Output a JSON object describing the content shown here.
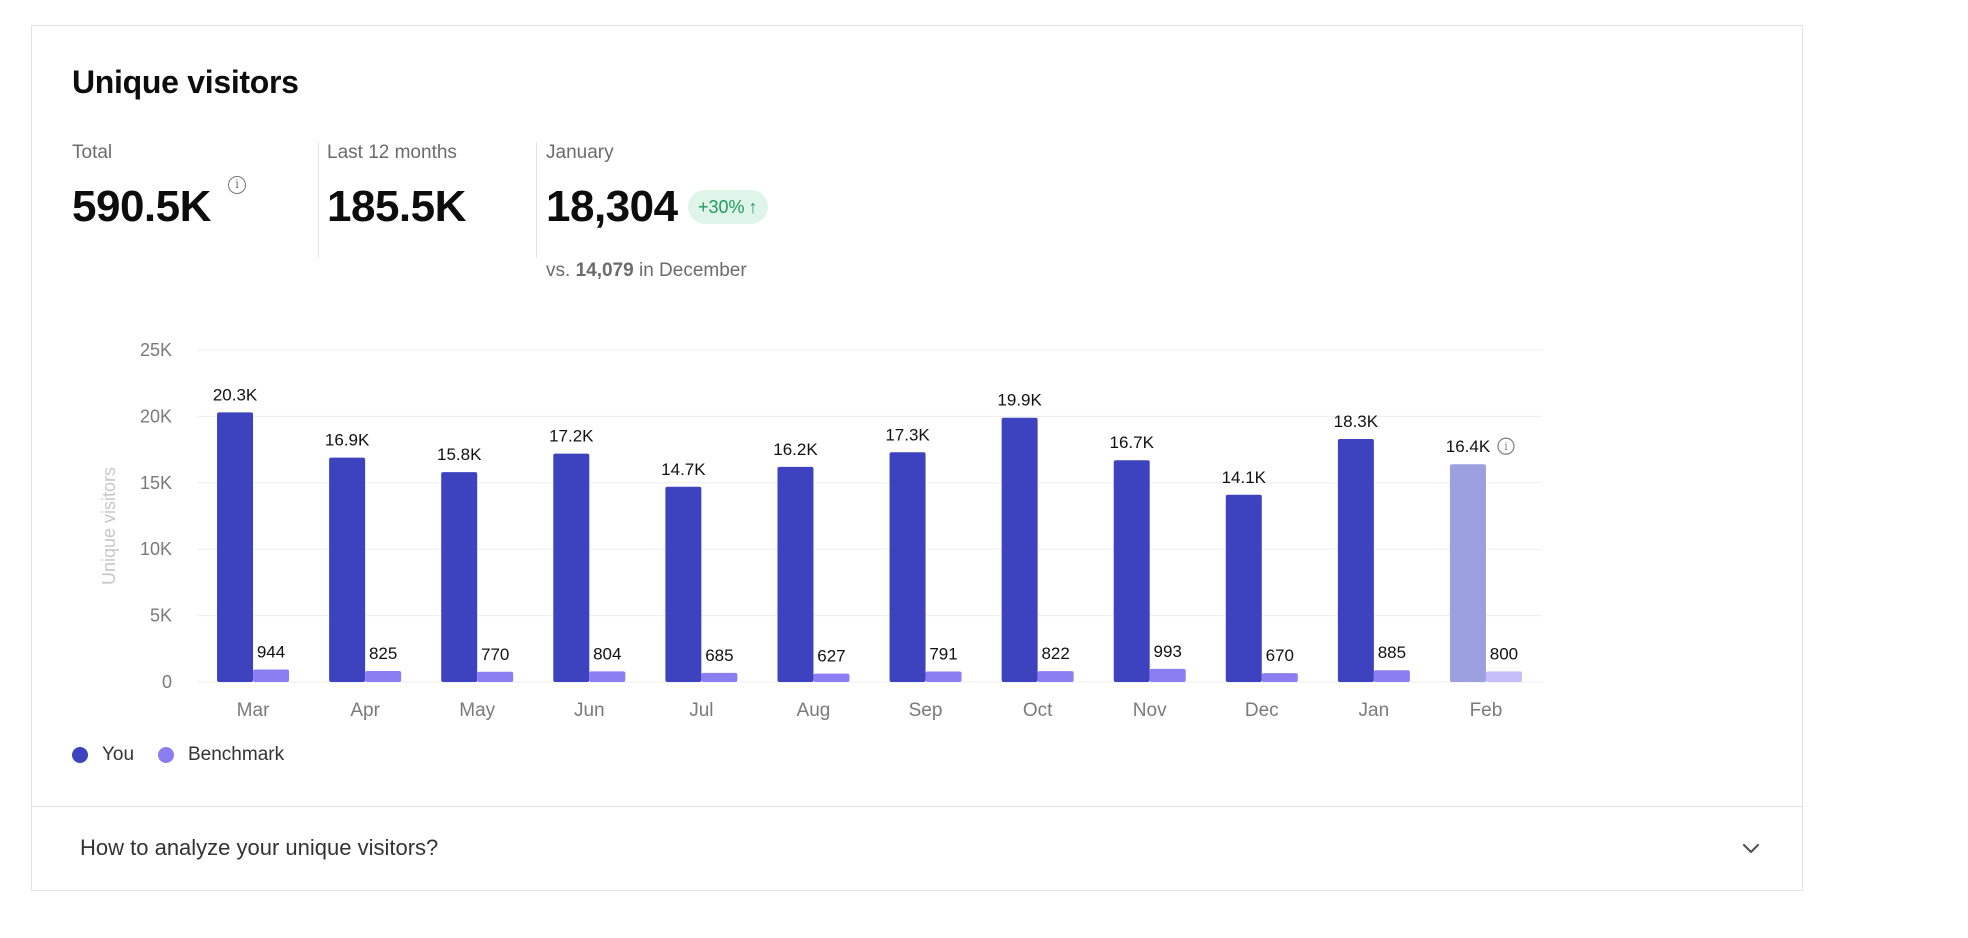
{
  "card": {
    "title": "Unique visitors",
    "stats": {
      "total": {
        "label": "Total",
        "value": "590.5K"
      },
      "last12": {
        "label": "Last 12 months",
        "value": "185.5K"
      },
      "month": {
        "label": "January",
        "value": "18,304",
        "badge": "+30%",
        "compare_prefix": "vs.",
        "compare_value": "14,079",
        "compare_suffix": "in December"
      }
    },
    "legend": {
      "you": "You",
      "benchmark": "Benchmark"
    },
    "faq": {
      "label": "How to analyze your unique visitors?"
    }
  },
  "colors": {
    "you": "#3d43be",
    "you_projected": "#9c9fe0",
    "benchmark": "#8b7df2",
    "benchmark_projected": "#c5bdf8",
    "badge_bg": "#dff5ea",
    "badge_text": "#1f9a5a"
  },
  "icons": [
    "info-icon",
    "arrow-up-icon",
    "chevron-down-icon"
  ],
  "chart_data": {
    "type": "bar",
    "ylabel": "Unique visitors",
    "ylim": [
      0,
      25000
    ],
    "yticks": [
      0,
      5000,
      10000,
      15000,
      20000,
      25000
    ],
    "ytick_labels": [
      "0",
      "5K",
      "10K",
      "15K",
      "20K",
      "25K"
    ],
    "categories": [
      "Mar",
      "Apr",
      "May",
      "Jun",
      "Jul",
      "Aug",
      "Sep",
      "Oct",
      "Nov",
      "Dec",
      "Jan",
      "Feb"
    ],
    "series": [
      {
        "name": "You",
        "values": [
          20300,
          16900,
          15800,
          17200,
          14700,
          16200,
          17300,
          19900,
          16700,
          14100,
          18300,
          16400
        ],
        "labels": [
          "20.3K",
          "16.9K",
          "15.8K",
          "17.2K",
          "14.7K",
          "16.2K",
          "17.3K",
          "19.9K",
          "16.7K",
          "14.1K",
          "18.3K",
          "16.4K"
        ]
      },
      {
        "name": "Benchmark",
        "values": [
          944,
          825,
          770,
          804,
          685,
          627,
          791,
          822,
          993,
          670,
          885,
          800
        ],
        "labels": [
          "944",
          "825",
          "770",
          "804",
          "685",
          "627",
          "791",
          "822",
          "993",
          "670",
          "885",
          "800"
        ]
      }
    ],
    "projected_category": "Feb",
    "grid": true
  }
}
